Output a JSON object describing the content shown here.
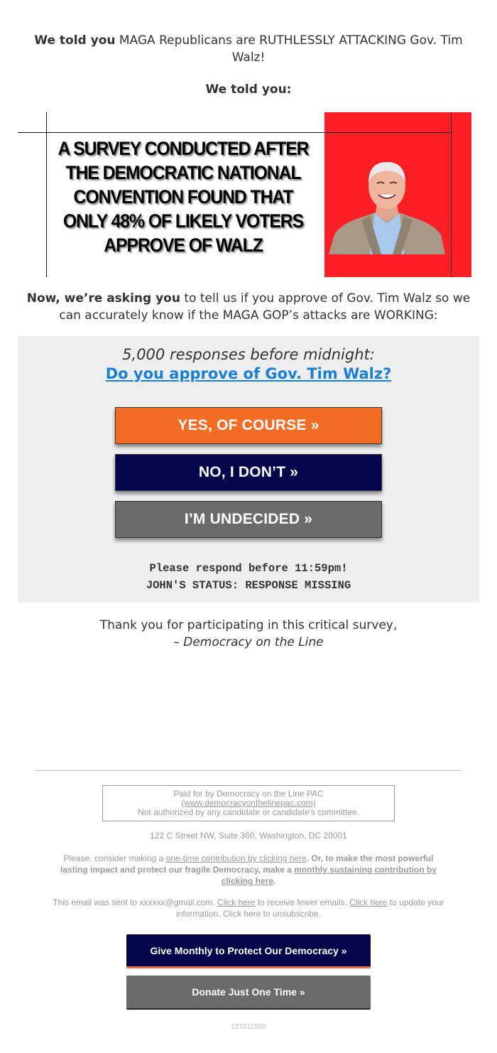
{
  "intro": {
    "lead_bold": "We told you",
    "lead_rest": " MAGA Republicans are RUTHLESSLY ATTACKING Gov. Tim Walz!",
    "we_told_you": "We told you:"
  },
  "banner": {
    "headline": "A SURVEY CONDUCTED AFTER THE DEMOCRATIC NATIONAL CONVENTION FOUND THAT ONLY 48% OF LIKELY VOTERS APPROVE OF WALZ",
    "photo_alt": "Gov. Tim Walz portrait",
    "accent_color": "#fe1e26"
  },
  "asking": {
    "bold": "Now, we’re asking you",
    "rest": " to tell us if you approve of Gov. Tim Walz so we can accurately know if the MAGA GOP’s attacks are WORKING:"
  },
  "survey": {
    "count_text": "5,000 responses before midnight:",
    "question_link": "Do you approve of Gov. Tim Walz?",
    "buttons": [
      {
        "label": "YES, OF COURSE »",
        "color": "#f26c24"
      },
      {
        "label": "NO, I DON’T »",
        "color": "#04044b"
      },
      {
        "label": "I’M UNDECIDED »",
        "color": "#6b6b6b"
      }
    ],
    "deadline": "Please respond before 11:59pm!",
    "status": "JOHN'S STATUS: RESPONSE MISSING"
  },
  "thanks": {
    "line1": "Thank you for participating in this critical survey,",
    "signature": "– Democracy on the Line"
  },
  "footer": {
    "paid_for": "Paid for by Democracy on the Line PAC",
    "website_link": "(www.democracyonthelinepac.com)",
    "not_authorized": "Not authorized by any candidate or candidate's committee.",
    "address": "122 C Street NW, Suite 360, Washington, DC 20001",
    "contrib_pre": "Please, consider making a ",
    "contrib_link1": "one-time contribution by clicking here",
    "contrib_mid": ". Or, to make the most powerful lasting impact and protect our fragile Democracy, make a ",
    "contrib_link2": "monthly sustaining contribution by clicking here",
    "contrib_end": ".",
    "sent_pre": "This email was sent to xxxxxx@gmail.com. ",
    "sent_link1": "Click here",
    "sent_mid1": " to receive fewer emails. ",
    "sent_link2": "Click here",
    "sent_mid2": " to update your information. Click here to unsubscribe.",
    "btn_monthly": "Give Monthly to Protect Our Democracy »",
    "btn_once": "Donate Just One Time »",
    "code": "127211550"
  }
}
